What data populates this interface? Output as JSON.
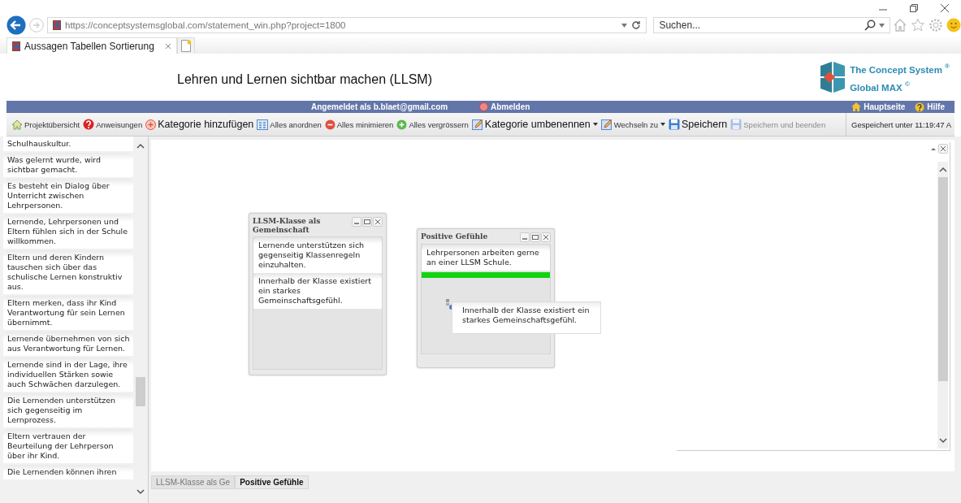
{
  "browser": {
    "url": "https://conceptsystemsglobal.com/statement_win.php?project=1800",
    "search_placeholder": "Suchen...",
    "tabs": [
      {
        "label": "Aussagen Tabellen Sortierung",
        "selected": true
      }
    ]
  },
  "header": {
    "title": "Lehren und Lernen sichtbar machen (LLSM)",
    "logo_line1": "The Concept System $^{®}$",
    "logo_line2": "Global MAX $^{©}$"
  },
  "user_bar": {
    "signed_in": "Angemeldet als b.blaet@gmail.com",
    "logout": "Abmelden",
    "links": [
      "Hauptseite",
      "Hilfe"
    ]
  },
  "toolbar": {
    "items": [
      {
        "label": "Projektübersicht",
        "emphasis": false,
        "dropdown": false,
        "disabled": false
      },
      {
        "label": "Anweisungen",
        "emphasis": false,
        "dropdown": false,
        "disabled": false
      },
      {
        "label": "Kategorie hinzufügen",
        "emphasis": true,
        "dropdown": false,
        "disabled": false
      },
      {
        "label": "Alles anordnen",
        "emphasis": false,
        "dropdown": false,
        "disabled": false
      },
      {
        "label": "Alles minimieren",
        "emphasis": false,
        "dropdown": false,
        "disabled": false
      },
      {
        "label": "Alles vergrössern",
        "emphasis": false,
        "dropdown": false,
        "disabled": false
      },
      {
        "label": "Kategorie umbenennen",
        "emphasis": true,
        "dropdown": true,
        "disabled": false
      },
      {
        "label": "Wechseln zu",
        "emphasis": false,
        "dropdown": true,
        "disabled": false
      },
      {
        "label": "Speichern",
        "emphasis": true,
        "dropdown": false,
        "disabled": false
      },
      {
        "label": "Speichern und beenden",
        "emphasis": false,
        "dropdown": false,
        "disabled": true
      }
    ],
    "status": "Gespeichert unter 11:19:47 A"
  },
  "statements": [
    "Schulhauskultur.",
    "Was gelernt wurde, wird sichtbar gemacht.",
    "Es besteht ein Dialog über Unterricht zwischen Lehrpersonen.",
    "Lernende, Lehrpersonen und Eltern fühlen sich in der Schule willkommen.",
    "Eltern und deren Kindern tauschen sich über das schulische Lernen konstruktiv aus.",
    "Eltern merken, dass ihr Kind Verantwortung für sein Lernen übernimmt.",
    "Lernende übernehmen von sich aus Verantwortung für Lernen.",
    "Lernende sind in der Lage, ihre individuellen Stärken sowie auch Schwächen darzulegen.",
    "Die Lernenden unterstützen sich gegenseitig im Lernprozess.",
    "Eltern vertrauen der Beurteilung der Lehrperson über ihr Kind.",
    "Die Lernenden können ihren"
  ],
  "categories": [
    {
      "title": "LLSM-Klasse als Gemeinschaft",
      "drop_indicator": false,
      "statements": [
        "Lernende unterstützen sich gegenseitig Klassenregeln einzuhalten.",
        "Innerhalb der Klasse existiert ein starkes Gemeinschaftsgefühl."
      ]
    },
    {
      "title": "Positive Gefühle",
      "drop_indicator": true,
      "statements": [
        "Lehrpersonen arbeiten gerne an einer LLSM Schule."
      ]
    }
  ],
  "dragged_statement": "Innerhalb der Klasse existiert ein starkes Gemeinschaftsgefühl.",
  "category_tabs": [
    {
      "label": "LLSM-Klasse als Ge",
      "selected": false
    },
    {
      "label": "Positive Gefühle",
      "selected": true
    }
  ]
}
